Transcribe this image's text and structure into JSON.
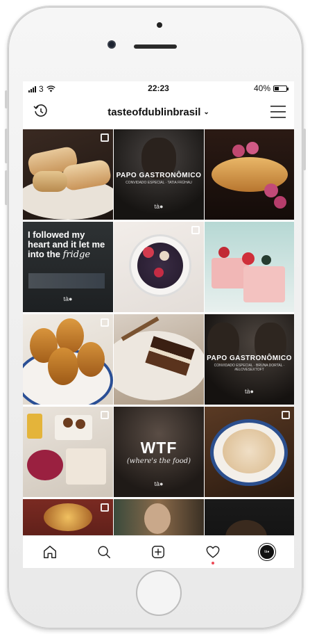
{
  "status": {
    "carrier": "3",
    "time": "22:23",
    "battery_text": "40%",
    "battery_level": 0.4
  },
  "header": {
    "username": "tasteofdublinbrasil",
    "chevron": "⌄"
  },
  "grid": {
    "tile2": {
      "title": "PAPO GASTRONÔMICO",
      "sub": "CONVIDADO ESPECIAL · TATIA FRÜHAU",
      "brand": "tà●"
    },
    "tile4": {
      "quote": "I followed my heart and it let me into the",
      "quote_script": "fridge",
      "brand": "tà●"
    },
    "tile9": {
      "title": "PAPO GASTRONÔMICO",
      "sub": "CONVIDADO ESPECIAL · BRUNA DORTAL · #ELOVESEXTOFT",
      "brand": "tà●"
    },
    "tile11": {
      "big": "WTF",
      "script": "(where's the food)",
      "brand": "tà●"
    }
  },
  "tabbar": {
    "avatar_text": "tà●"
  },
  "colors": {
    "notification": "#ed4956",
    "text": "#111111"
  }
}
